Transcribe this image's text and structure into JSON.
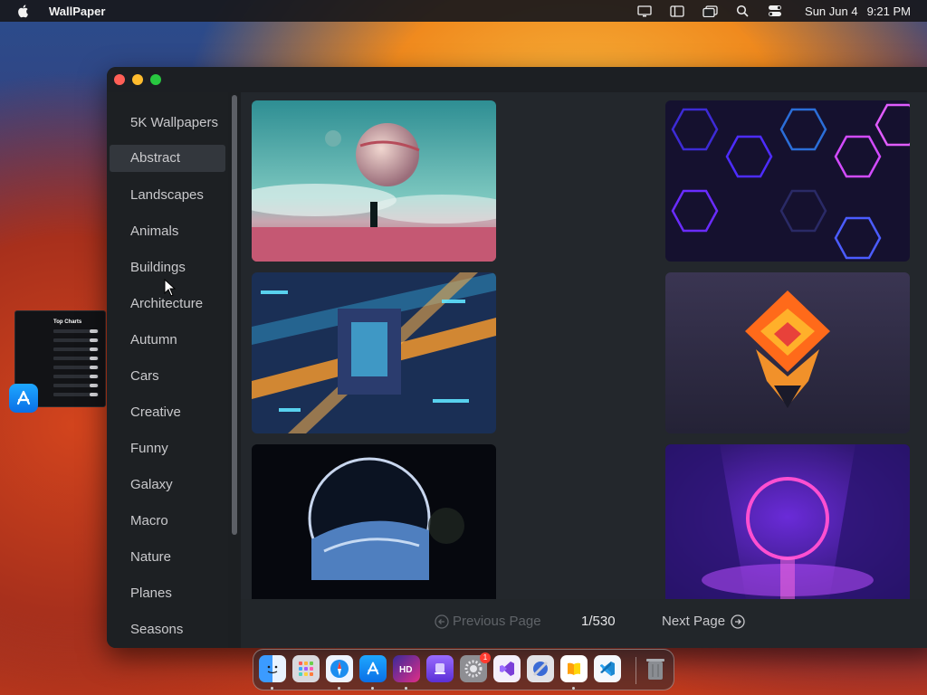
{
  "menubar": {
    "app_name": "WallPaper",
    "date": "Sun Jun 4",
    "time": "9:21 PM",
    "icons": [
      "apple-icon",
      "display-icon",
      "sidebar-icon",
      "window-icon",
      "search-icon",
      "control-center-icon"
    ]
  },
  "sidebar": {
    "categories": [
      "5K Wallpapers",
      "Abstract",
      "Landscapes",
      "Animals",
      "Buildings",
      "Architecture",
      "Autumn",
      "Cars",
      "Creative",
      "Funny",
      "Galaxy",
      "Macro",
      "Nature",
      "Planes",
      "Seasons"
    ],
    "selected": "Abstract"
  },
  "gallery": {
    "images": [
      {
        "subject": "Surreal planet landscape",
        "colors": [
          "#4fb3ad",
          "#b6596c"
        ]
      },
      {
        "subject": "Neon hexagon pattern",
        "colors": [
          "#201a4a",
          "#a43dff"
        ]
      },
      {
        "subject": "Neon cyberpunk city",
        "colors": [
          "#1c3a6a",
          "#ff9d2b"
        ]
      },
      {
        "subject": "Geometric flame diamond",
        "colors": [
          "#302c4a",
          "#ff6a1a"
        ]
      },
      {
        "subject": "Earth through portal",
        "colors": [
          "#05070d",
          "#5a86c5"
        ]
      },
      {
        "subject": "Neon ring tunnel",
        "colors": [
          "#2a1766",
          "#ff4fd1"
        ]
      }
    ]
  },
  "pager": {
    "previous_label": "Previous Page",
    "page_indicator": "1/530",
    "next_label": "Next Page"
  },
  "mini_window": {
    "title": "Top Charts"
  },
  "dock": {
    "apps": [
      "finder-icon",
      "launchpad-icon",
      "safari-icon",
      "app-store-icon",
      "hd-app-icon",
      "purple-app-icon",
      "system-settings-icon",
      "visual-studio-icon",
      "xcode-instruments-icon",
      "books-icon",
      "vscode-icon",
      "trash-icon"
    ],
    "settings_badge": "1"
  }
}
